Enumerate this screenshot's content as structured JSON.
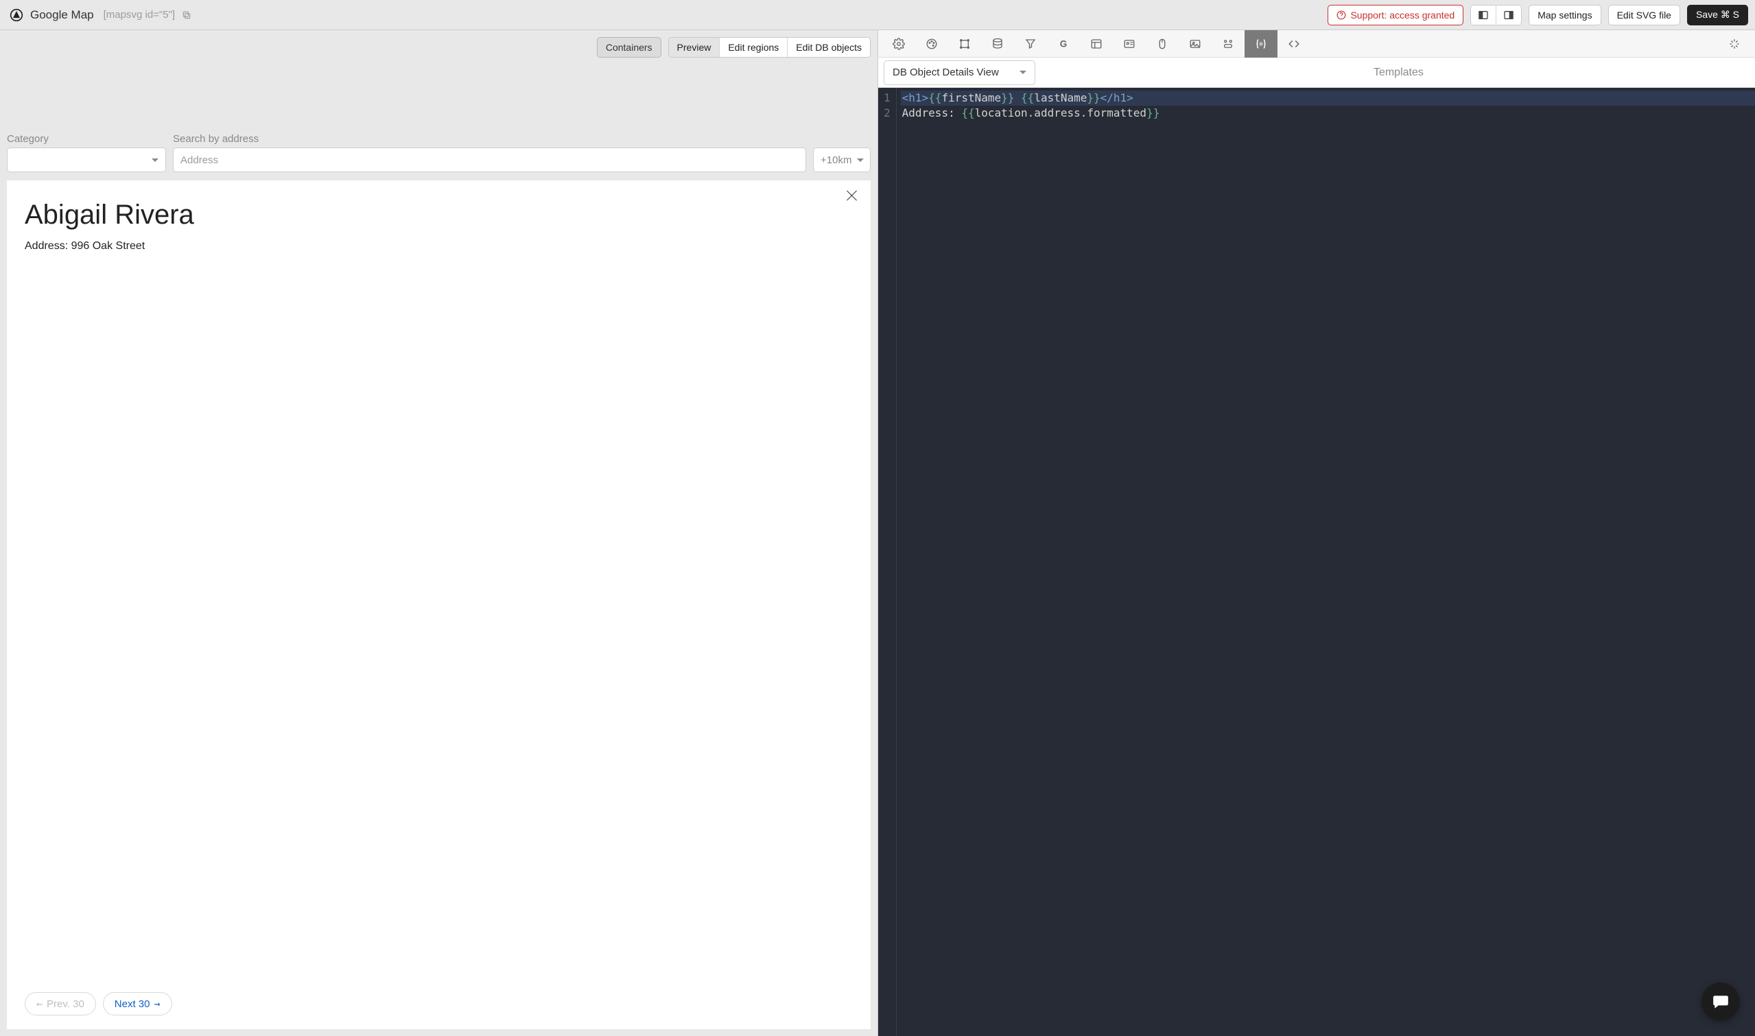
{
  "header": {
    "title": "Google Map",
    "shortcode": "[mapsvg id=\"5\"]",
    "support_label": "Support: access granted",
    "map_settings_label": "Map settings",
    "edit_svg_label": "Edit SVG file",
    "save_label": "Save ⌘ S"
  },
  "left": {
    "tabs": {
      "containers": "Containers",
      "preview": "Preview",
      "edit_regions": "Edit regions",
      "edit_db": "Edit DB objects"
    },
    "filters": {
      "category_label": "Category",
      "search_label": "Search by address",
      "address_placeholder": "Address",
      "distance_label": "+10km"
    },
    "detail": {
      "name": "Abigail Rivera",
      "address_line": "Address: 996 Oak Street"
    },
    "pager": {
      "prev": "Prev. 30",
      "next": "Next 30"
    }
  },
  "right": {
    "selector_label": "DB Object Details View",
    "templates_label": "Templates",
    "code": {
      "line1": {
        "open": "<h1>",
        "b1": "{{",
        "v1": "firstName",
        "b2": "}}",
        "sp": " ",
        "b3": "{{",
        "v2": "lastName",
        "b4": "}}",
        "close": "</h1>"
      },
      "line2": {
        "label": "Address: ",
        "b1": "{{",
        "v1": "location.address.formatted",
        "b2": "}}"
      }
    }
  }
}
